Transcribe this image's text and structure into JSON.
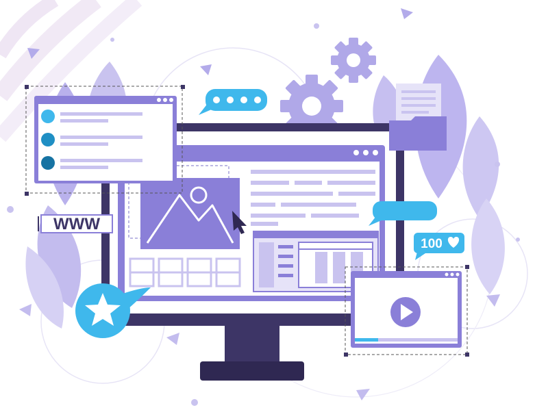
{
  "colors": {
    "purple_dark": "#3d3566",
    "purple_mid": "#8a7fd8",
    "purple_light": "#c9c3ef",
    "purple_pale": "#e6e3f8",
    "accent_blue": "#3fb8ec",
    "accent_blue_dark": "#1f8fc4",
    "accent_teal_dark": "#1673a3",
    "stand": "#3d3566"
  },
  "url_badge": {
    "text": "WWW"
  },
  "likes_badge": {
    "count": "100",
    "icon": "heart-icon"
  },
  "chat_bubble": {
    "icon": "typing-dots-icon"
  },
  "video_window": {
    "icon": "play-icon"
  },
  "gear": {
    "icon": "gear-icon"
  },
  "star_badge": {
    "icon": "star-icon"
  },
  "cursor": {
    "icon": "mouse-pointer-icon"
  },
  "folder": {
    "icon": "folder-icon"
  },
  "image_placeholder": {
    "icon": "mountain-image-icon"
  }
}
